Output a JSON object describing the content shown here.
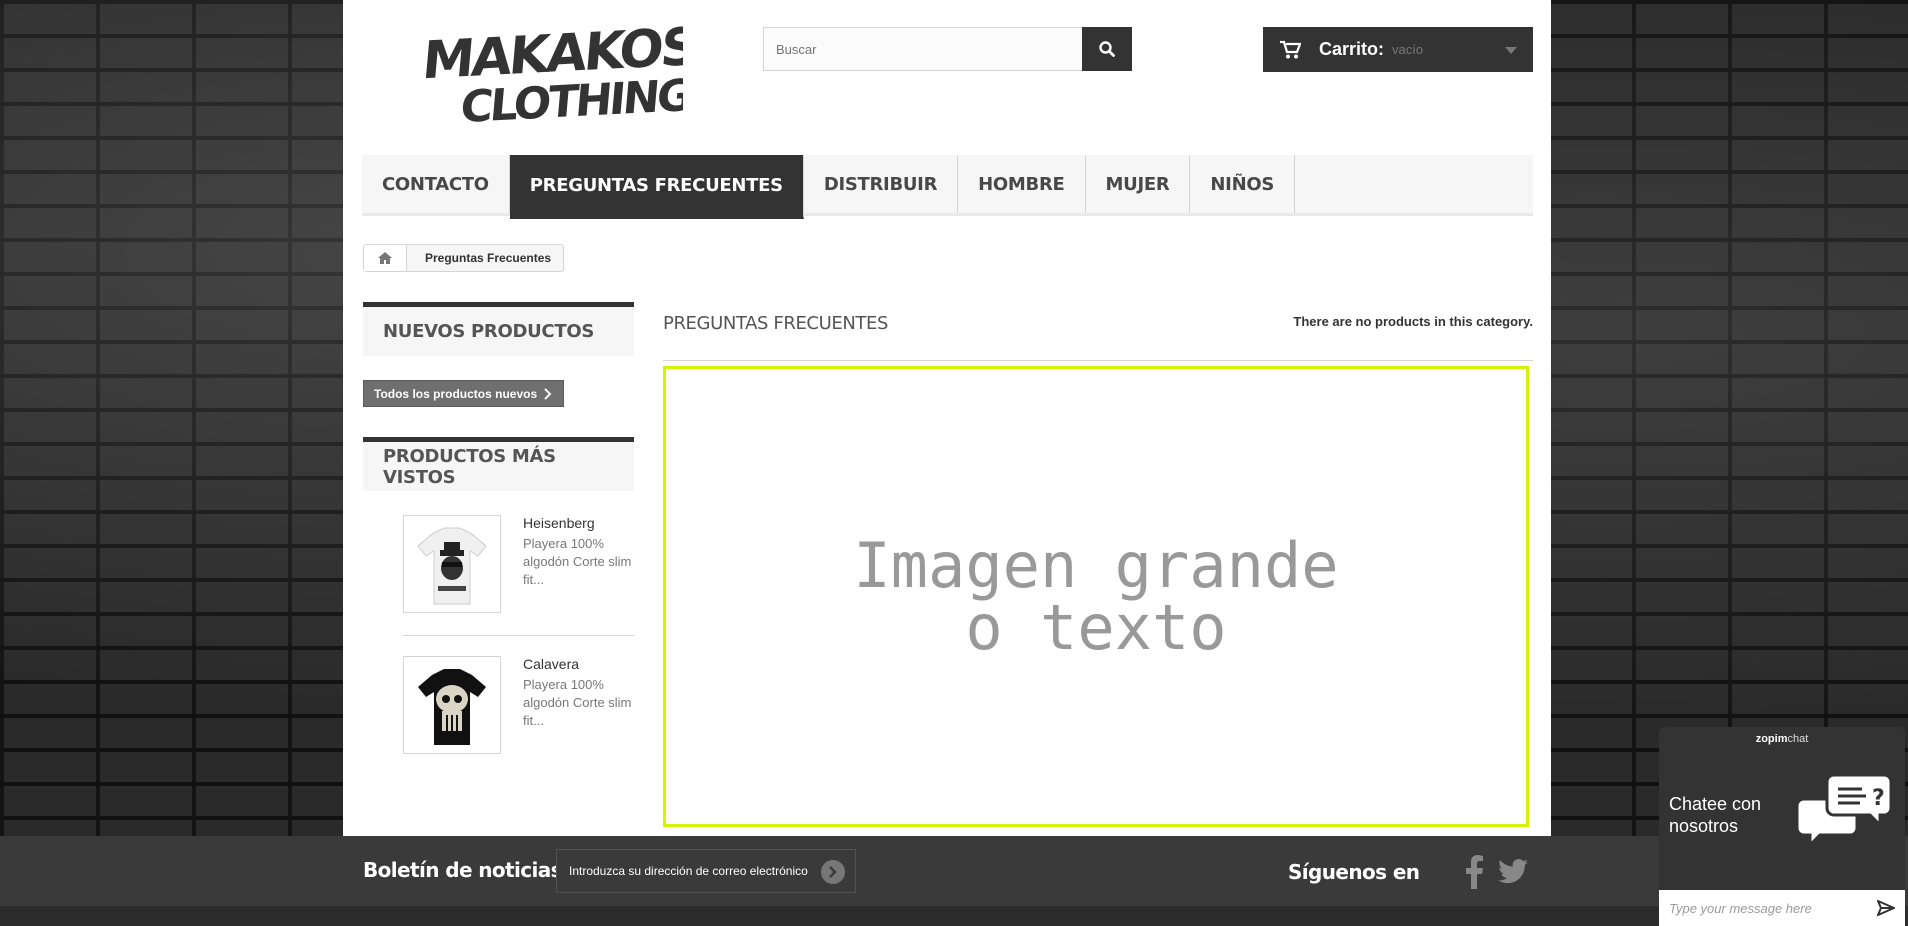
{
  "header": {
    "logo_line1": "MAKAKOS",
    "logo_line2": "CLOTHING",
    "search_placeholder": "Buscar",
    "search_icon": "search-icon",
    "cart_label": "Carrito:",
    "cart_value": "vacío",
    "cart_icon": "cart-icon"
  },
  "nav": {
    "items": [
      {
        "label": "CONTACTO",
        "active": false
      },
      {
        "label": "PREGUNTAS FRECUENTES",
        "active": true
      },
      {
        "label": "DISTRIBUIR",
        "active": false
      },
      {
        "label": "HOMBRE",
        "active": false
      },
      {
        "label": "MUJER",
        "active": false
      },
      {
        "label": "NIÑOS",
        "active": false
      }
    ]
  },
  "breadcrumb": {
    "home_icon": "home-icon",
    "current": "Preguntas Frecuentes"
  },
  "sidebar": {
    "new_products_title": "NUEVOS PRODUCTOS",
    "all_new_button": "Todos los productos nuevos",
    "most_viewed_title": "PRODUCTOS MÁS VISTOS",
    "products": [
      {
        "name": "Heisenberg",
        "description": "Playera 100% algodón Corte slim fit..."
      },
      {
        "name": "Calavera",
        "description": "Playera 100% algodón  Corte slim fit..."
      }
    ]
  },
  "main": {
    "title": "PREGUNTAS FRECUENTES",
    "no_products": "There are no products in this category.",
    "hero_text": "Imagen grande\no texto"
  },
  "footer": {
    "newsletter_label": "Boletín de noticias",
    "newsletter_placeholder": "Introduzca su dirección de correo electrónico",
    "follow_label": "Síguenos en",
    "social_icons": [
      "facebook-icon",
      "twitter-icon"
    ]
  },
  "chat": {
    "brand": "zopim",
    "brand_suffix": "chat",
    "cta": "Chatee con nosotros",
    "message_placeholder": "Type your message here"
  },
  "colors": {
    "accent_dark": "#333333",
    "hero_border": "#d4f207",
    "footer_bg": "#3a3a3a"
  }
}
